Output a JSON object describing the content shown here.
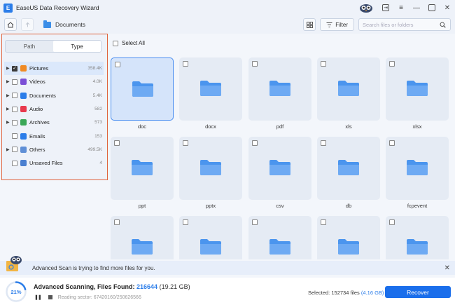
{
  "window": {
    "title": "EaseUS Data Recovery Wizard",
    "controls": [
      "mascot-icon",
      "sign-in-icon",
      "menu-icon",
      "minimize-icon",
      "maximize-icon",
      "close-icon"
    ]
  },
  "toolbar": {
    "breadcrumb": "Documents",
    "filter_label": "Filter",
    "search_placeholder": "Search files or folders"
  },
  "sidebar": {
    "tabs": [
      {
        "label": "Path",
        "active": false
      },
      {
        "label": "Type",
        "active": true
      }
    ],
    "items": [
      {
        "label": "Pictures",
        "count": "358.4K",
        "has_caret": true,
        "checked": true,
        "selected": true,
        "icon": "pictures-icon",
        "color": "#f08a24"
      },
      {
        "label": "Videos",
        "count": "4.0K",
        "has_caret": true,
        "checked": false,
        "selected": false,
        "icon": "videos-icon",
        "color": "#7b4fd6"
      },
      {
        "label": "Documents",
        "count": "5.4K",
        "has_caret": true,
        "checked": false,
        "selected": false,
        "icon": "documents-icon",
        "color": "#2b7de9"
      },
      {
        "label": "Audio",
        "count": "582",
        "has_caret": true,
        "checked": false,
        "selected": false,
        "icon": "audio-icon",
        "color": "#e8394d"
      },
      {
        "label": "Archives",
        "count": "573",
        "has_caret": true,
        "checked": false,
        "selected": false,
        "icon": "archives-icon",
        "color": "#3aa757"
      },
      {
        "label": "Emails",
        "count": "153",
        "has_caret": false,
        "checked": false,
        "selected": false,
        "icon": "emails-icon",
        "color": "#2b7de9"
      },
      {
        "label": "Others",
        "count": "499.5K",
        "has_caret": true,
        "checked": false,
        "selected": false,
        "icon": "others-icon",
        "color": "#5f8fd6"
      },
      {
        "label": "Unsaved Files",
        "count": "4",
        "has_caret": false,
        "checked": false,
        "selected": false,
        "icon": "unsaved-files-icon",
        "color": "#4a7fd0"
      }
    ]
  },
  "main": {
    "select_all_label": "Select All",
    "files": [
      {
        "name": "doc",
        "selected": true
      },
      {
        "name": "docx",
        "selected": false
      },
      {
        "name": "pdf",
        "selected": false
      },
      {
        "name": "xls",
        "selected": false
      },
      {
        "name": "xlsx",
        "selected": false
      },
      {
        "name": "ppt",
        "selected": false
      },
      {
        "name": "pptx",
        "selected": false
      },
      {
        "name": "csv",
        "selected": false
      },
      {
        "name": "db",
        "selected": false
      },
      {
        "name": "fcpevent",
        "selected": false
      },
      {
        "name": "",
        "selected": false
      },
      {
        "name": "",
        "selected": false
      },
      {
        "name": "",
        "selected": false
      },
      {
        "name": "",
        "selected": false
      },
      {
        "name": "",
        "selected": false
      }
    ]
  },
  "notice": {
    "text": "Advanced Scan is trying to find more files for you."
  },
  "status": {
    "progress": "21%",
    "progress_fraction": 0.21,
    "scan_label": "Advanced Scanning, Files Found:",
    "files_found": "216644",
    "found_size": "(19.21 GB)",
    "reading_sector": "Reading sector: 67420160/250626566",
    "selected_label": "Selected: 152734 files",
    "selected_size": "(4.16 GB)",
    "recover_label": "Recover"
  },
  "colors": {
    "accent": "#1a6eeb",
    "folder": "#4b95ee",
    "highlight_border": "#e0643f"
  }
}
